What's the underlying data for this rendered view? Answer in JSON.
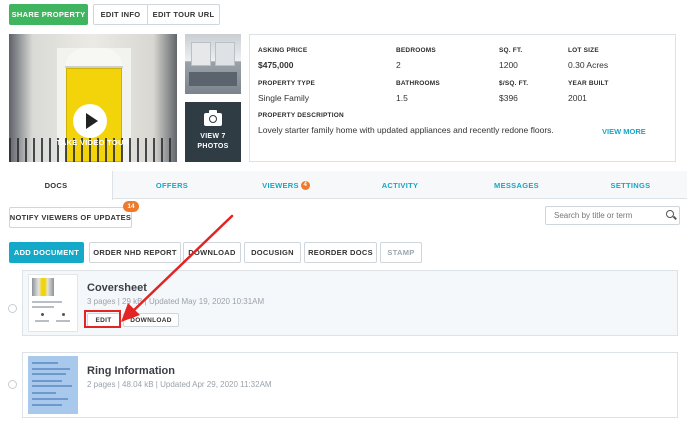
{
  "top_actions": {
    "share": "SHARE PROPERTY",
    "edit_info": "EDIT INFO",
    "edit_tour": "EDIT TOUR URL"
  },
  "media": {
    "tour_label": "TAKE VIDEO TOUR",
    "view_photos_line1": "VIEW 7",
    "view_photos_line2": "PHOTOS"
  },
  "property": {
    "asking_price_label": "ASKING PRICE",
    "asking_price": "$475,000",
    "bedrooms_label": "BEDROOMS",
    "bedrooms": "2",
    "sqft_label": "SQ. FT.",
    "sqft": "1200",
    "lot_label": "LOT SIZE",
    "lot": "0.30 Acres",
    "type_label": "PROPERTY TYPE",
    "type": "Single Family",
    "bathrooms_label": "BATHROOMS",
    "bathrooms": "1.5",
    "per_sqft_label": "$/SQ. FT.",
    "per_sqft": "$396",
    "year_label": "YEAR BUILT",
    "year": "2001",
    "desc_label": "PROPERTY DESCRIPTION",
    "desc": "Lovely starter family home with updated appliances and recently redone floors.",
    "view_more": "VIEW MORE"
  },
  "tabs": [
    {
      "label": "DOCS"
    },
    {
      "label": "OFFERS"
    },
    {
      "label": "VIEWERS",
      "badge": "4"
    },
    {
      "label": "ACTIVITY"
    },
    {
      "label": "MESSAGES"
    },
    {
      "label": "SETTINGS"
    }
  ],
  "notify": {
    "label": "NOTIFY VIEWERS OF UPDATES",
    "badge": "14"
  },
  "search": {
    "placeholder": "Search by title or term"
  },
  "doc_actions": {
    "add": "ADD DOCUMENT",
    "order_nhd": "ORDER NHD REPORT",
    "download": "DOWNLOAD",
    "docusign": "DOCUSIGN",
    "reorder": "REORDER DOCS",
    "stamp": "STAMP"
  },
  "documents": [
    {
      "title": "Coversheet",
      "meta": "3 pages | 29 kB | Updated May 19, 2020 10:31AM",
      "edit": "EDIT",
      "download": "DOWNLOAD"
    },
    {
      "title": "Ring Information",
      "meta": "2 pages | 48.04 kB | Updated Apr 29, 2020 11:32AM"
    }
  ],
  "colors": {
    "accent": "#14a8c9",
    "share": "#3eb55e",
    "badge": "#f07a2b",
    "annotation": "#e22424"
  }
}
